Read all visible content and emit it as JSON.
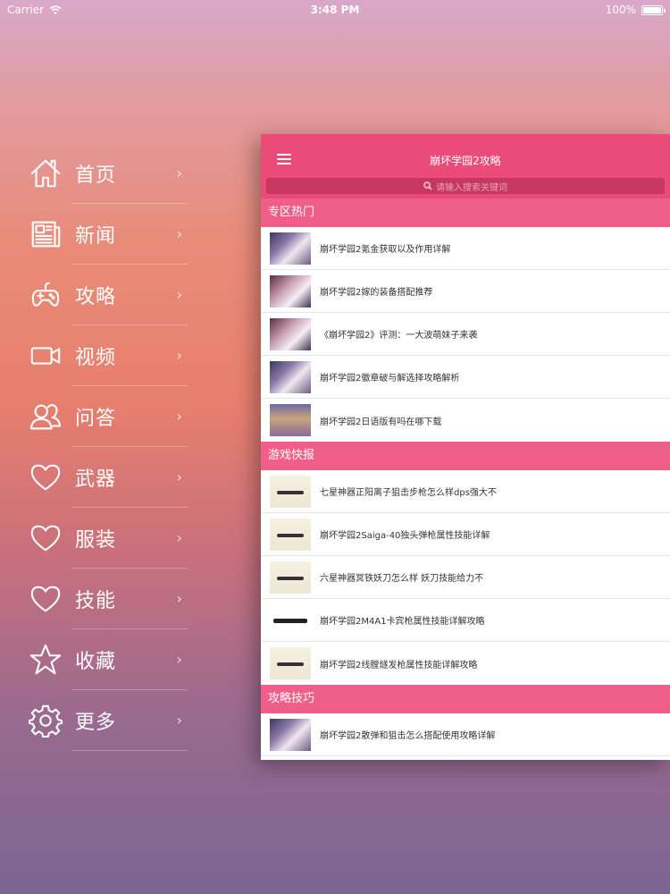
{
  "status": {
    "carrier": "Carrier",
    "time": "3:48 PM",
    "battery": "100%"
  },
  "menu": [
    {
      "label": "首页",
      "icon": "home-icon"
    },
    {
      "label": "新闻",
      "icon": "newspaper-icon"
    },
    {
      "label": "攻略",
      "icon": "gamepad-icon"
    },
    {
      "label": "视频",
      "icon": "video-camera-icon"
    },
    {
      "label": "问答",
      "icon": "users-icon"
    },
    {
      "label": "武器",
      "icon": "heart-icon"
    },
    {
      "label": "服装",
      "icon": "heart-icon"
    },
    {
      "label": "技能",
      "icon": "heart-icon"
    },
    {
      "label": "收藏",
      "icon": "star-icon"
    },
    {
      "label": "更多",
      "icon": "gear-icon"
    }
  ],
  "panel": {
    "title": "崩坏学园2攻略",
    "search_placeholder": "请输入搜索关键词",
    "sections": [
      {
        "title": "专区热门",
        "items": [
          "崩坏学园2氪金获取以及作用详解",
          "崩坏学园2嫁的装备搭配推荐",
          "《崩坏学园2》评测：一大波萌妹子来袭",
          "崩坏学园2徽章破与解选择攻略解析",
          "崩坏学园2日语版有吗在哪下载"
        ]
      },
      {
        "title": "游戏快报",
        "items": [
          "七星神器正阳离子狙击步枪怎么样dps强大不",
          "崩坏学园2Saiga-40独头弹枪属性技能详解",
          "六星神器冥铁妖刀怎么样 妖刀技能给力不",
          "崩坏学园2M4A1卡宾枪属性技能详解攻略",
          "崩坏学园2线膛燧发枪属性技能详解攻略"
        ]
      },
      {
        "title": "攻略技巧",
        "items": [
          "崩坏学园2散弹和狙击怎么搭配使用攻略详解"
        ]
      }
    ]
  }
}
